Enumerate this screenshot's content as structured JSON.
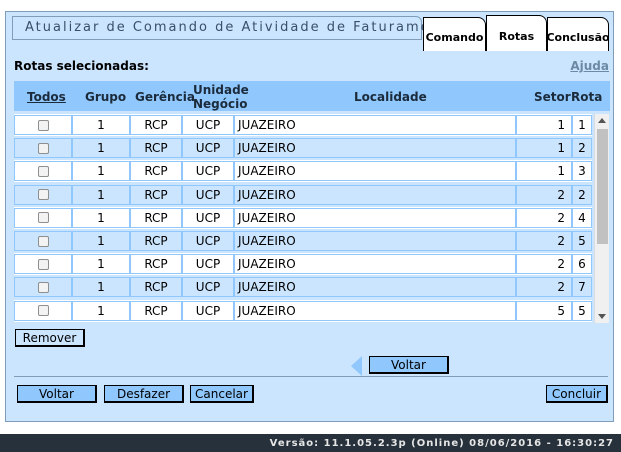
{
  "header": {
    "title": "Atualizar de Comando de Atividade de Faturamento",
    "tabs": [
      {
        "label": "Comando"
      },
      {
        "label": "Rotas"
      },
      {
        "label": "Conclusão"
      }
    ]
  },
  "section": {
    "label": "Rotas selecionadas:",
    "help": "Ajuda"
  },
  "table": {
    "headers": {
      "todos": "Todos",
      "grupo": "Grupo",
      "gerencia": "Gerência",
      "unidade_l1": "Unidade",
      "unidade_l2": "Negócio",
      "localidade": "Localidade",
      "setor": "Setor",
      "rota": "Rota"
    },
    "rows": [
      {
        "grupo": "1",
        "gerencia": "RCP",
        "unidade": "UCP",
        "localidade": "JUAZEIRO",
        "setor": "1",
        "rota": "1"
      },
      {
        "grupo": "1",
        "gerencia": "RCP",
        "unidade": "UCP",
        "localidade": "JUAZEIRO",
        "setor": "1",
        "rota": "2"
      },
      {
        "grupo": "1",
        "gerencia": "RCP",
        "unidade": "UCP",
        "localidade": "JUAZEIRO",
        "setor": "1",
        "rota": "3"
      },
      {
        "grupo": "1",
        "gerencia": "RCP",
        "unidade": "UCP",
        "localidade": "JUAZEIRO",
        "setor": "2",
        "rota": "2"
      },
      {
        "grupo": "1",
        "gerencia": "RCP",
        "unidade": "UCP",
        "localidade": "JUAZEIRO",
        "setor": "2",
        "rota": "4"
      },
      {
        "grupo": "1",
        "gerencia": "RCP",
        "unidade": "UCP",
        "localidade": "JUAZEIRO",
        "setor": "2",
        "rota": "5"
      },
      {
        "grupo": "1",
        "gerencia": "RCP",
        "unidade": "UCP",
        "localidade": "JUAZEIRO",
        "setor": "2",
        "rota": "6"
      },
      {
        "grupo": "1",
        "gerencia": "RCP",
        "unidade": "UCP",
        "localidade": "JUAZEIRO",
        "setor": "2",
        "rota": "7"
      },
      {
        "grupo": "1",
        "gerencia": "RCP",
        "unidade": "UCP",
        "localidade": "JUAZEIRO",
        "setor": "5",
        "rota": "5"
      }
    ]
  },
  "buttons": {
    "remover": "Remover",
    "voltar_nav": "Voltar",
    "voltar": "Voltar",
    "desfazer": "Desfazer",
    "cancelar": "Cancelar",
    "concluir": "Concluir"
  },
  "footer": {
    "version": "Versão: 11.1.05.2.3p (Online) 08/06/2016 - 16:30:27"
  },
  "colors": {
    "panel": "#cbe5fe",
    "header": "#90c7fc",
    "row_alt": "#cbe5fe",
    "footer": "#27313b"
  }
}
